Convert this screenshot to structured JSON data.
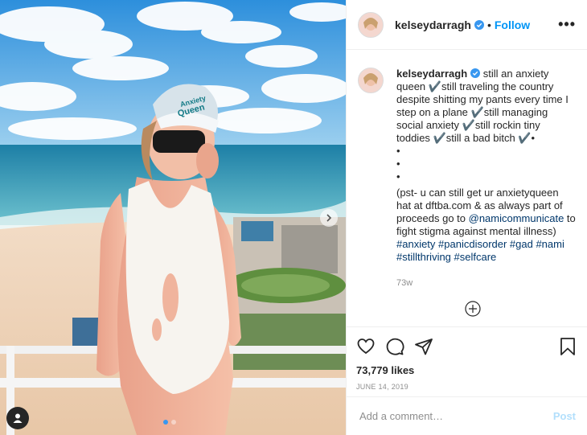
{
  "post": {
    "username": "kelseydarragh",
    "verified": true,
    "separator": "•",
    "follow_label": "Follow",
    "more_label": "•••"
  },
  "caption": {
    "username": "kelseydarragh",
    "text_1": " still an anxiety queen ✔️still traveling the country despite shitting my pants every time I step on a plane ✔️still managing social anxiety ✔️still rockin tiny toddies ✔️still a bad bitch ✔️•",
    "bullets": [
      "•",
      "•",
      "•"
    ],
    "text_2": "(pst- u can still get ur anxietyqueen hat at dftba.com & as always part of proceeds go to ",
    "mention": "@namicommunicate",
    "text_3": " to fight stigma against mental illness) ",
    "hashtags": "#anxiety #panicdisorder #gad #nami #stillthriving #selfcare",
    "time_ago": "73w"
  },
  "photo": {
    "hat_text_1": "Anxiety",
    "hat_text_2": "Queen",
    "slide_count": 2,
    "active_slide": 1
  },
  "actions": {
    "likes": "73,779 likes",
    "date": "JUNE 14, 2019"
  },
  "comment_box": {
    "placeholder": "Add a comment…",
    "post_label": "Post"
  },
  "icons": [
    "heart-icon",
    "comment-icon",
    "share-icon",
    "bookmark-icon",
    "verified-icon",
    "next-arrow-icon",
    "user-tag-icon",
    "load-more-icon"
  ],
  "colors": {
    "link": "#00376b",
    "follow": "#0095f6",
    "post_disabled": "#b2dffc",
    "verified": "#3897f0"
  }
}
